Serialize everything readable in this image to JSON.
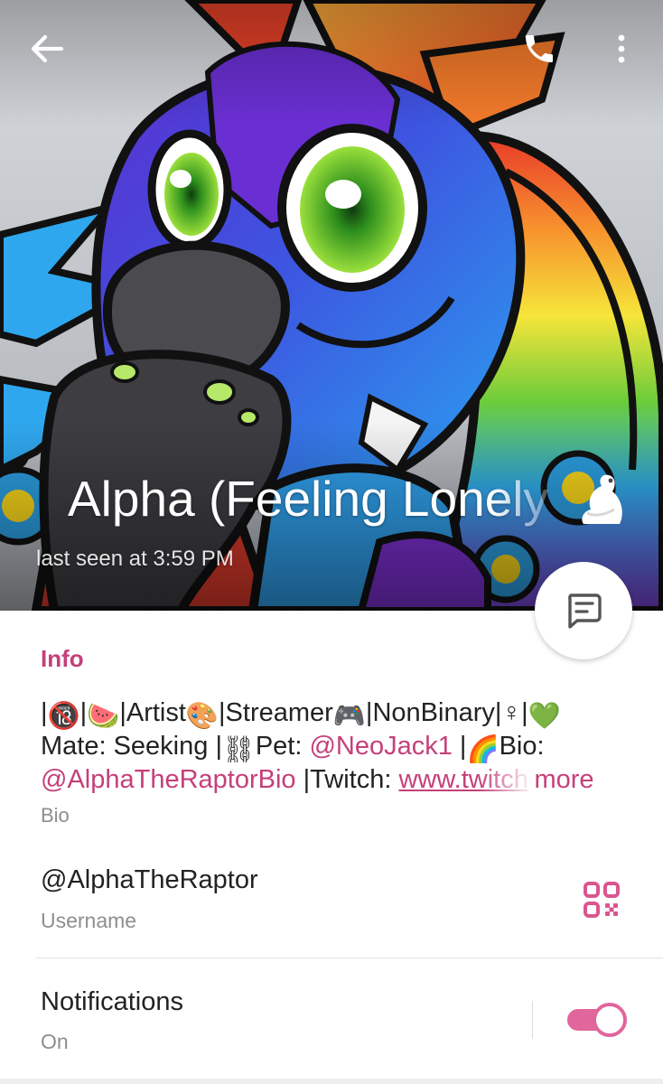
{
  "header": {
    "name": "Alpha (Feeling Lonely",
    "last_seen": "last seen at 3:59 PM",
    "icons": {
      "back": "arrow-left-icon",
      "call": "phone-icon",
      "more": "more-vertical-icon",
      "message": "message-icon",
      "name_emoji": "peacock-emoji"
    }
  },
  "info": {
    "heading": "Info",
    "bio": {
      "line1": {
        "sep1": "|",
        "emoji_18": "🔞",
        "sep2": "|",
        "emoji_melon": "🍉",
        "artist": "|Artist",
        "emoji_palette": "🎨",
        "streamer": "|Streamer",
        "emoji_gamepad": "🎮",
        "nonbinary": "|NonBinary|",
        "symbol": "♀",
        "sep3": "|",
        "emoji_heart": "💚"
      },
      "line2": {
        "mate": "Mate: Seeking |",
        "emoji_chain": "⛓",
        "pet": "Pet: ",
        "pet_handle": "@NeoJack1",
        "sep": " |",
        "emoji_rainbow": "🌈",
        "bio_label": "Bio:"
      },
      "line3": {
        "bio_handle": "@AlphaTheRaptorBio",
        "twitch_label": " |Twitch: ",
        "twitch_url": "www.twitch",
        "more": "more"
      },
      "caption": "Bio"
    },
    "username": {
      "value": "@AlphaTheRaptor",
      "caption": "Username",
      "qr_icon": "qr-code-icon"
    },
    "notifications": {
      "title": "Notifications",
      "status": "On",
      "enabled": true
    }
  },
  "colors": {
    "accent": "#c5407a",
    "toggle": "#e0669c",
    "secondary_text": "#8e8e8e",
    "primary_text": "#222222"
  }
}
